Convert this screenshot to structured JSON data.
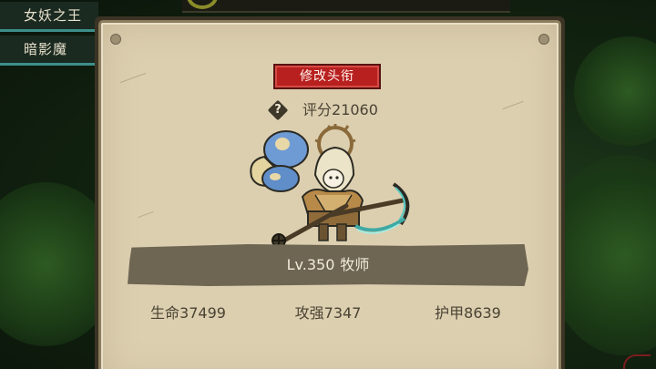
{
  "sidebar": {
    "items": [
      {
        "label": "女妖之王"
      },
      {
        "label": "暗影魔"
      }
    ]
  },
  "modal": {
    "rename_button_label": "修改头衔",
    "help_icon_glyph": "?",
    "score": {
      "label": "评分",
      "value": "21060"
    },
    "character": {
      "icon": "priest-character-sprite"
    },
    "level_bar": {
      "level_text": "Lv.350",
      "class_name": "牧师"
    },
    "stats": [
      {
        "name": "生命",
        "value": "37499"
      },
      {
        "name": "攻强",
        "value": "7347"
      },
      {
        "name": "护甲",
        "value": "8639"
      }
    ]
  },
  "colors": {
    "panel_bg": "#dccfb0",
    "panel_border": "#8a7c5d",
    "rename_button_bg": "#b8201f",
    "level_bar_bg": "#6e6653",
    "text_dark": "#4a4333",
    "sidebar_accent": "#3c8f8a",
    "background": "#132511"
  }
}
